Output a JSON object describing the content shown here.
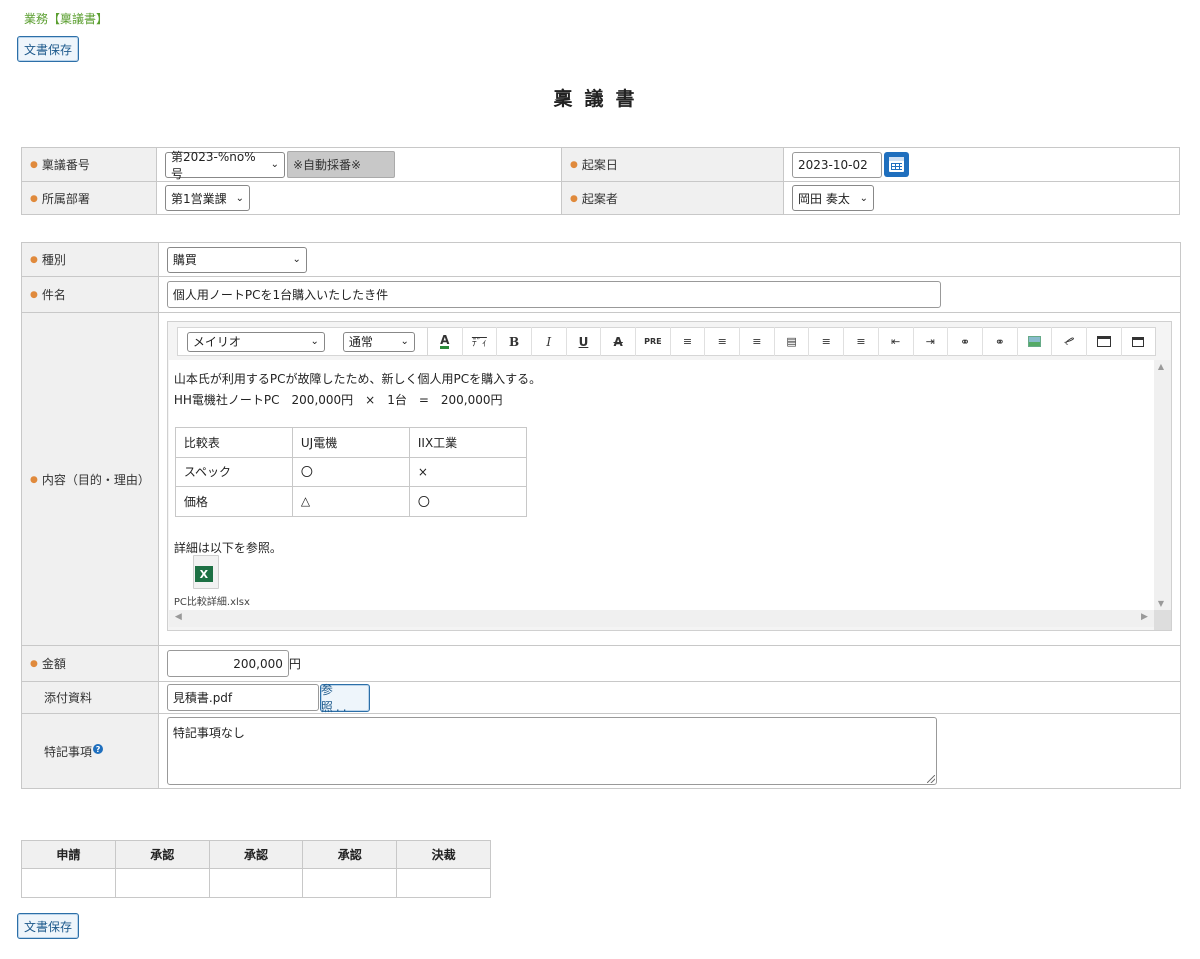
{
  "breadcrumb": "業務【稟議書】",
  "save_button": "文書保存",
  "page_title": "稟議書",
  "header_fields": {
    "ringi_number": {
      "label": "稟議番号",
      "value": "第2023-%no%号",
      "auto_note": "※自動採番※"
    },
    "draft_date": {
      "label": "起案日",
      "value": "2023-10-02"
    },
    "department": {
      "label": "所属部署",
      "value": "第1営業課"
    },
    "drafter": {
      "label": "起案者",
      "value": "岡田 奏太"
    }
  },
  "fields": {
    "category": {
      "label": "種別",
      "value": "購買"
    },
    "subject": {
      "label": "件名",
      "value": "個人用ノートPCを1台購入いたしたき件"
    },
    "content": {
      "label": "内容（目的・理由）",
      "editor": {
        "font": "メイリオ",
        "size": "通常",
        "toolbar_icons": [
          "font-color-icon",
          "highlight-icon",
          "bold-icon",
          "italic-icon",
          "underline-icon",
          "strikethrough-icon",
          "preformatted-icon",
          "align-left-icon",
          "align-center-icon",
          "align-right-icon",
          "justify-icon",
          "ordered-list-icon",
          "unordered-list-icon",
          "outdent-icon",
          "indent-icon",
          "link-icon",
          "unlink-icon",
          "image-icon",
          "attachment-icon",
          "table-icon",
          "html-source-icon"
        ],
        "line1": "山本氏が利用するPCが故障したため、新しく個人用PCを購入する。",
        "line2": "HH電機社ノートPC　200,000円　×　1台　=　200,000円",
        "table": [
          [
            "比較表",
            "UJ電機",
            "IIX工業"
          ],
          [
            "スペック",
            "〇",
            "×"
          ],
          [
            "価格",
            "△",
            "〇"
          ]
        ],
        "line3": "詳細は以下を参照。",
        "attachment": "PC比較詳細.xlsx"
      }
    },
    "amount": {
      "label": "金額",
      "value": "200,000",
      "unit": "円"
    },
    "attachment": {
      "label": "添付資料",
      "value": "見積書.pdf",
      "browse": "参 照.."
    },
    "special_notes": {
      "label": "特記事項",
      "value": "特記事項なし"
    }
  },
  "approval": {
    "headers": [
      "申請",
      "承認",
      "承認",
      "承認",
      "決裁"
    ]
  },
  "colors": {
    "accent": "#1f6fbe",
    "breadcrumb": "#5a9e2f",
    "required_mark": "#e08a3c",
    "excel": "#1d7044"
  }
}
